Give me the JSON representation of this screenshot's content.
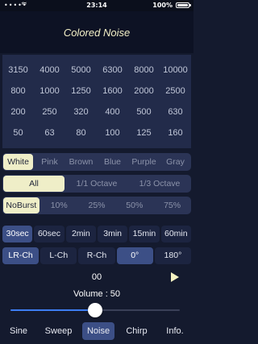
{
  "status_bar": {
    "carrier": "•••••",
    "time": "23:14",
    "battery": "100%"
  },
  "header": {
    "title": "Colored Noise"
  },
  "frequencies": [
    "3150",
    "4000",
    "5000",
    "6300",
    "8000",
    "10000",
    "800",
    "1000",
    "1250",
    "1600",
    "2000",
    "2500",
    "200",
    "250",
    "320",
    "400",
    "500",
    "630",
    "50",
    "63",
    "80",
    "100",
    "125",
    "160"
  ],
  "color_selector": {
    "options": [
      "White",
      "Pink",
      "Brown",
      "Blue",
      "Purple",
      "Gray"
    ],
    "selected": "White"
  },
  "band_selector": {
    "options": [
      "All",
      "1/1 Octave",
      "1/3 Octave"
    ],
    "selected": "All"
  },
  "burst_selector": {
    "options": [
      "NoBurst",
      "10%",
      "25%",
      "50%",
      "75%"
    ],
    "selected": "NoBurst"
  },
  "duration_buttons": {
    "options": [
      "30sec",
      "60sec",
      "2min",
      "3min",
      "15min",
      "60min"
    ],
    "selected": "30sec"
  },
  "channel_buttons": {
    "options": [
      "LR-Ch",
      "L-Ch",
      "R-Ch",
      "0°",
      "180°"
    ],
    "selected": [
      "LR-Ch",
      "0°"
    ]
  },
  "playback": {
    "timer": "00"
  },
  "volume": {
    "label": "Volume : 50",
    "value": 50,
    "max": 100
  },
  "tab_bar": {
    "tabs": [
      "Sine",
      "Sweep",
      "Noise",
      "Chirp",
      "Info."
    ],
    "selected": "Noise"
  },
  "colors": {
    "accent": "#3d7df2",
    "selected_bg": "#efeec8",
    "title_text": "#f3f0c7"
  }
}
